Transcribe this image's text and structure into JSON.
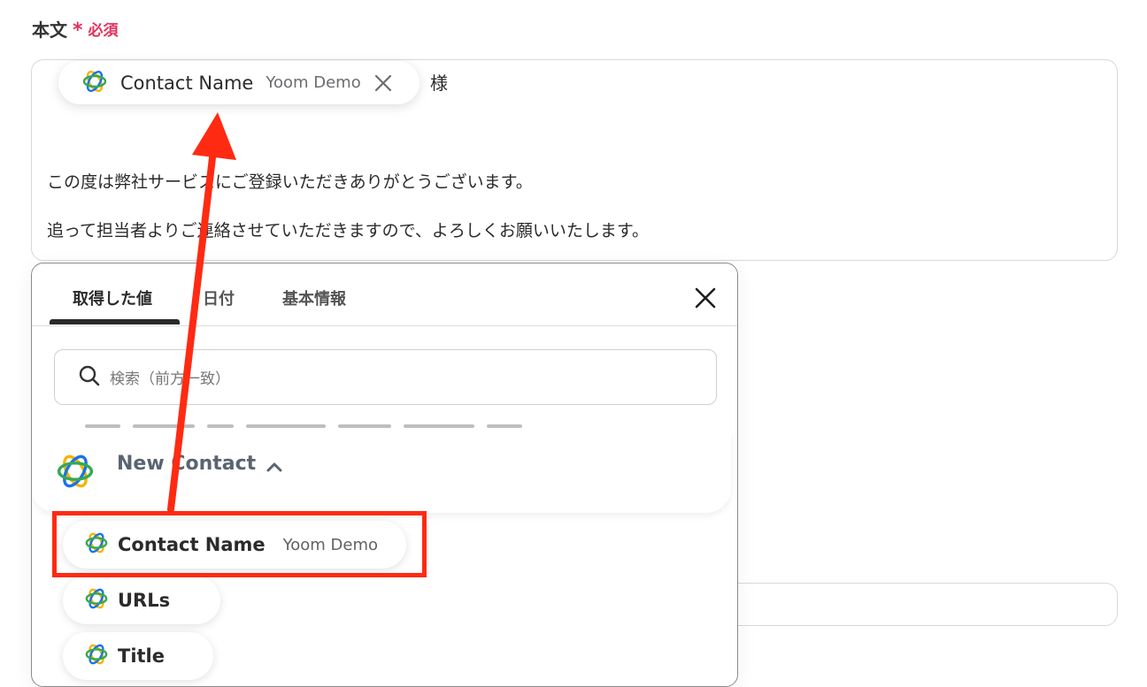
{
  "field": {
    "label": "本文",
    "required_star": "*",
    "required_text": "必須"
  },
  "editor": {
    "chip": {
      "name": "Contact Name",
      "app": "Yoom Demo"
    },
    "suffix": "様",
    "lines": [
      "この度は弊社サービスにご登録いただきありがとうございます。",
      "追って担当者よりご連絡させていただきますので、よろしくお願いいたします。"
    ]
  },
  "panel": {
    "tabs": [
      {
        "label": "取得した値",
        "active": true
      },
      {
        "label": "日付",
        "active": false
      },
      {
        "label": "基本情報",
        "active": false
      }
    ],
    "search_placeholder": "検索（前方一致）",
    "group": {
      "title": "New Contact",
      "expanded": true
    },
    "items": [
      {
        "name": "Contact Name",
        "app": "Yoom Demo",
        "highlighted": true
      },
      {
        "name": "URLs",
        "app": ""
      },
      {
        "name": "Title",
        "app": ""
      }
    ]
  },
  "colors": {
    "required": "#e0325d",
    "annotation": "#ff2a12",
    "text": "#2b2b2b"
  },
  "icons": [
    "yoom-logo-icon",
    "close-icon",
    "search-icon",
    "chevron-up-icon"
  ]
}
